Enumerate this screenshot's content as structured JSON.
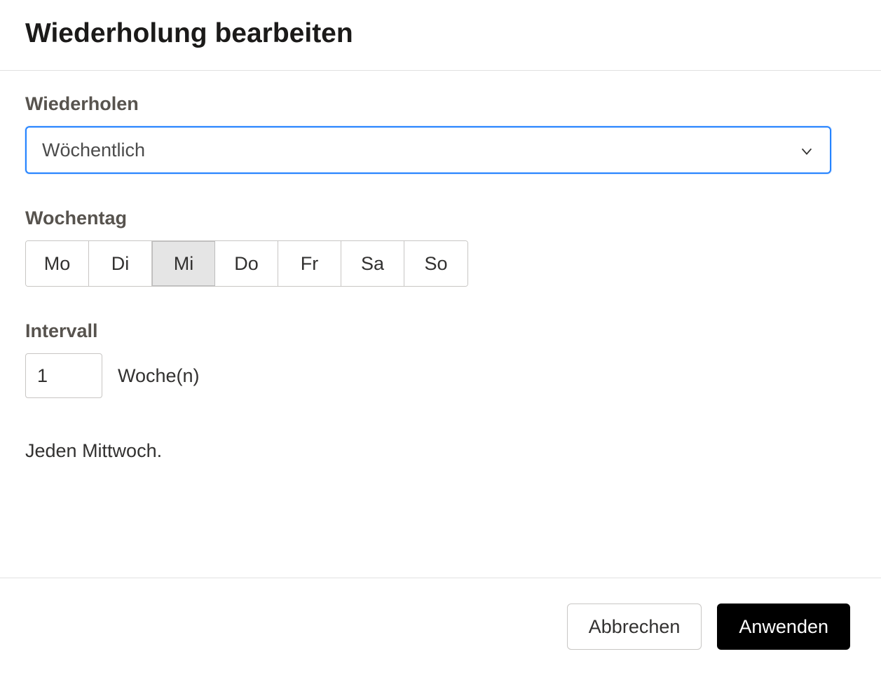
{
  "dialog": {
    "title": "Wiederholung bearbeiten"
  },
  "repeat": {
    "label": "Wiederholen",
    "selected": "Wöchentlich"
  },
  "weekday": {
    "label": "Wochentag",
    "days": [
      "Mo",
      "Di",
      "Mi",
      "Do",
      "Fr",
      "Sa",
      "So"
    ],
    "selected_index": 2
  },
  "interval": {
    "label": "Intervall",
    "value": "1",
    "unit": "Woche(n)"
  },
  "summary": "Jeden Mittwoch.",
  "footer": {
    "cancel": "Abbrechen",
    "apply": "Anwenden"
  }
}
